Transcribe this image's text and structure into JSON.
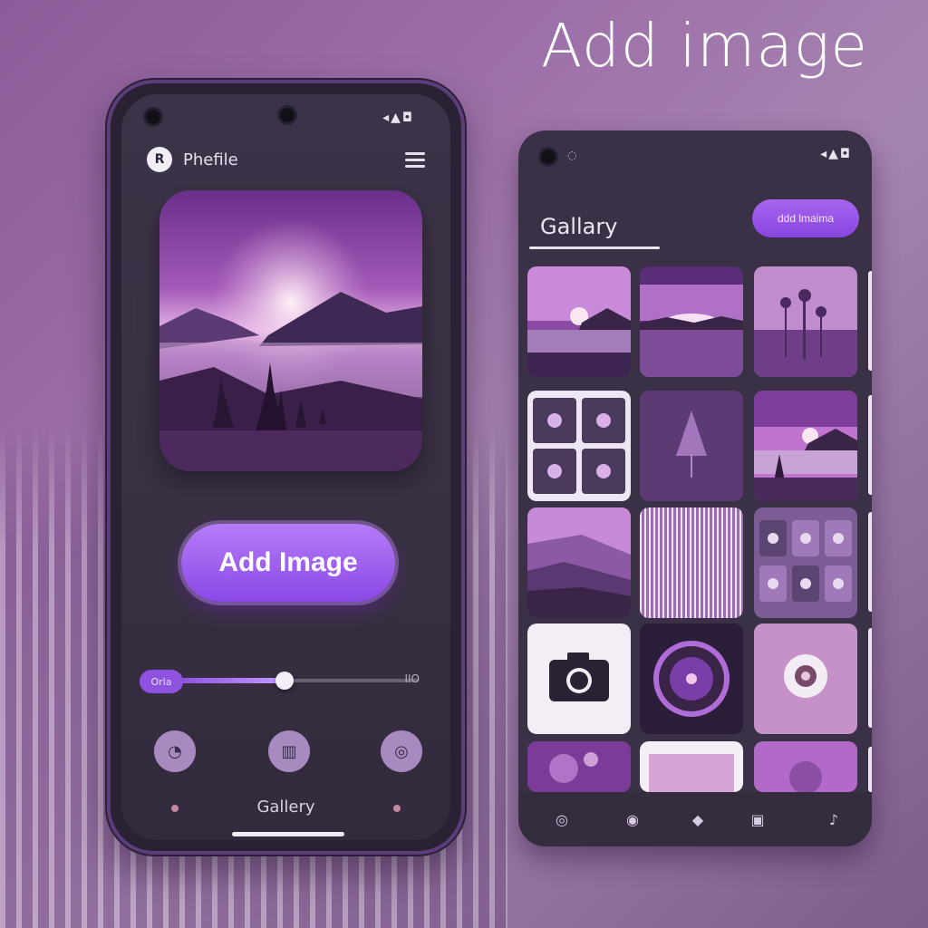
{
  "headline": "Add image",
  "left_phone": {
    "status_icons": "◂▲◘",
    "header": {
      "avatar_letter": "R",
      "title": "Phefile"
    },
    "add_button_label": "Add Image",
    "slider": {
      "pill_label": "Orla",
      "end_label": "IIO",
      "value_fraction": 0.44
    },
    "nav": {
      "label": "Gallery",
      "icons": [
        "chat-icon",
        "book-icon",
        "search-icon"
      ]
    }
  },
  "right_phone": {
    "left_status_text": "◌",
    "status_icons": "◂▲◘",
    "title": "Gallary",
    "add_button_label": "ddd lmaima",
    "tiles": [
      "sunset-mountain-lake",
      "purple-horizon",
      "purple-plants",
      "four-icon-grid",
      "purple-tree",
      "misty-mountain-sunset",
      "purple-hills",
      "striped-texture",
      "icon-grid",
      "camera-app",
      "lens-app",
      "camera-shutter-app",
      "purple-sparkle",
      "white-frame",
      "purple-orb"
    ],
    "bottom_nav_icons": [
      "home-icon",
      "swirl-icon",
      "pin-icon",
      "gallery-icon",
      "share-icon"
    ]
  },
  "colors": {
    "accent": "#8b48e6",
    "accent_light": "#b57cf7",
    "phone_body": "#3c3348",
    "background": "#9c6fa8"
  }
}
